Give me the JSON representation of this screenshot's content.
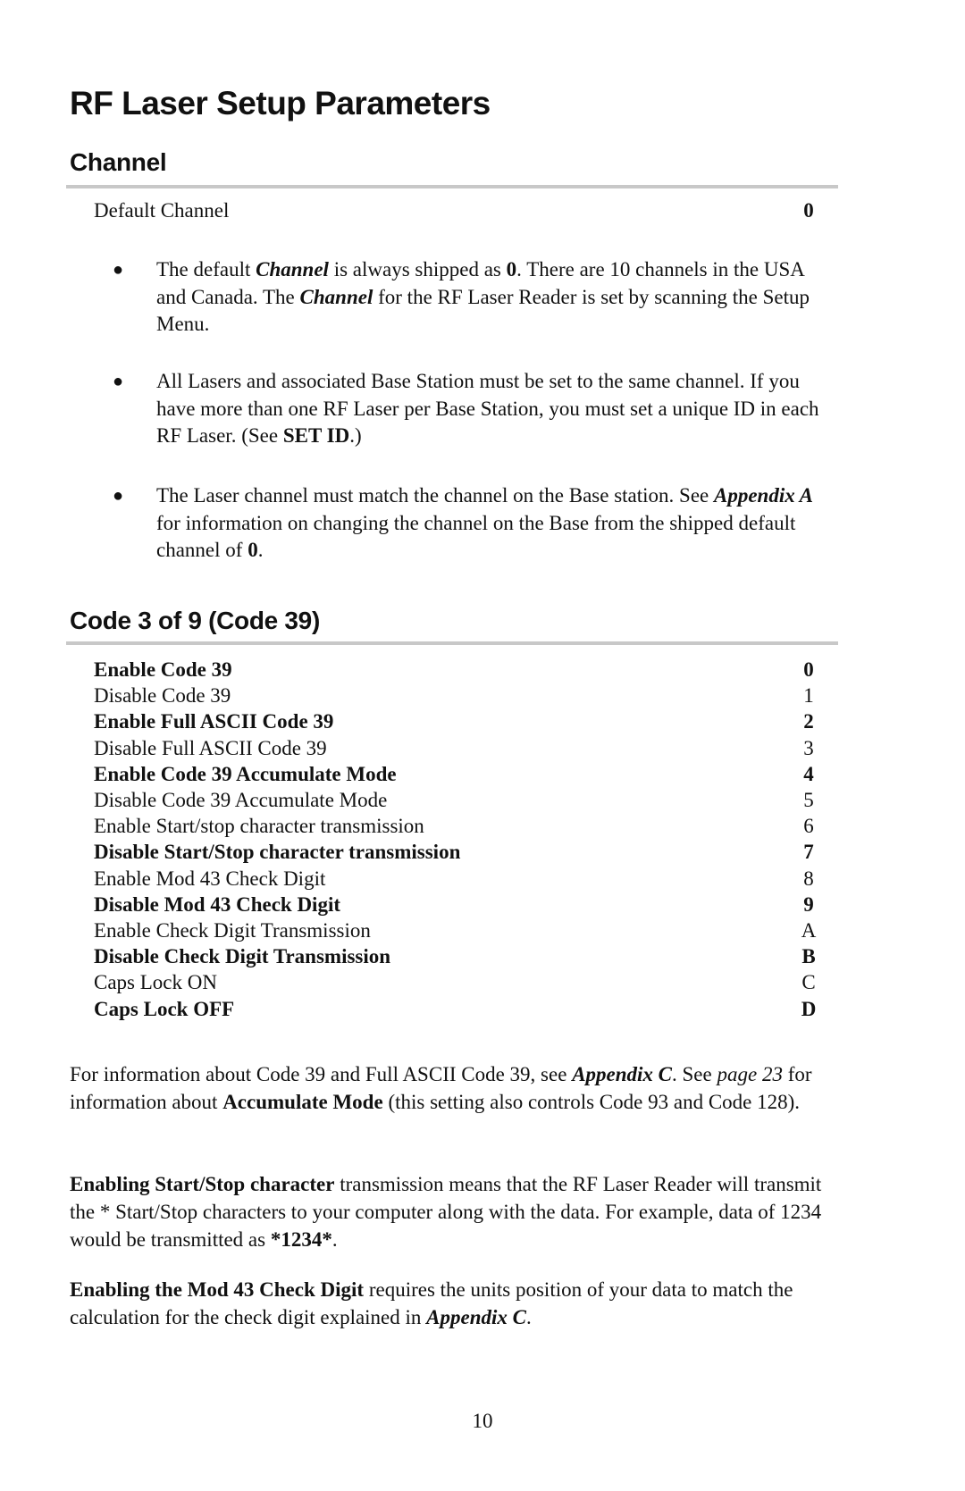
{
  "title": "RF Laser Setup Parameters",
  "channel_section": {
    "heading": "Channel",
    "default_label": "Default Channel",
    "default_value": "0",
    "bullets": [
      {
        "parts": [
          {
            "t": "The default ",
            "s": "n"
          },
          {
            "t": "Channel",
            "s": "bi"
          },
          {
            "t": " is always shipped as ",
            "s": "n"
          },
          {
            "t": "0",
            "s": "b"
          },
          {
            "t": ".  There are 10 channels in the USA and Canada.  The ",
            "s": "n"
          },
          {
            "t": "Channel",
            "s": "bi"
          },
          {
            "t": " for the RF Laser Reader is set by scanning the Setup Menu.",
            "s": "n"
          }
        ]
      },
      {
        "parts": [
          {
            "t": "All Lasers and associated Base Station must be set to the same channel. If you have more than one RF Laser per Base Station, you must set a unique ID in each RF Laser. (See ",
            "s": "n"
          },
          {
            "t": "SET ID",
            "s": "b"
          },
          {
            "t": ".)",
            "s": "n"
          }
        ]
      },
      {
        "parts": [
          {
            "t": "The Laser channel must match the channel on the Base station. See ",
            "s": "n"
          },
          {
            "t": "Appendix A",
            "s": "bi"
          },
          {
            "t": " for information on changing the channel on the Base from the shipped default channel of ",
            "s": "n"
          },
          {
            "t": "0",
            "s": "b"
          },
          {
            "t": ".",
            "s": "n"
          }
        ]
      }
    ]
  },
  "code39_section": {
    "heading": "Code 3 of 9 (Code 39)",
    "rows": [
      {
        "label": "Enable Code 39",
        "value": "0",
        "bold": true
      },
      {
        "label": "Disable Code 39",
        "value": "1",
        "bold": false
      },
      {
        "label": "Enable Full ASCII Code 39",
        "value": "2",
        "bold": true
      },
      {
        "label": "Disable Full ASCII Code 39",
        "value": "3",
        "bold": false
      },
      {
        "label": "Enable Code 39 Accumulate Mode",
        "value": "4",
        "bold": true
      },
      {
        "label": "Disable Code 39 Accumulate Mode",
        "value": "5",
        "bold": false
      },
      {
        "label": "Enable Start/stop character transmission",
        "value": "6",
        "bold": false
      },
      {
        "label": "Disable Start/Stop character transmission",
        "value": "7",
        "bold": true
      },
      {
        "label": "Enable Mod 43 Check Digit",
        "value": "8",
        "bold": false
      },
      {
        "label": "Disable Mod 43 Check Digit",
        "value": "9",
        "bold": true
      },
      {
        "label": "Enable Check Digit Transmission",
        "value": "A",
        "bold": false
      },
      {
        "label": "Disable Check Digit Transmission",
        "value": "B",
        "bold": true
      },
      {
        "label": "Caps Lock ON",
        "value": "C",
        "bold": false
      },
      {
        "label": "Caps Lock OFF",
        "value": "D",
        "bold": true
      }
    ],
    "paragraphs": [
      {
        "parts": [
          {
            "t": "For information about Code 39 and Full ASCII Code 39, see ",
            "s": "n"
          },
          {
            "t": "Appendix C",
            "s": "bi"
          },
          {
            "t": ". See ",
            "s": "n"
          },
          {
            "t": "page 23",
            "s": "i"
          },
          {
            "t": " for information about ",
            "s": "n"
          },
          {
            "t": "Accumulate Mode",
            "s": "b"
          },
          {
            "t": " (this setting also controls Code 93 and Code 128).",
            "s": "n"
          }
        ]
      },
      {
        "parts": [
          {
            "t": "Enabling Start/Stop character",
            "s": "b"
          },
          {
            "t": " transmission means that the RF Laser Reader will transmit the * Start/Stop characters to your computer along with the data. For example, data of 1234 would be transmitted as ",
            "s": "n"
          },
          {
            "t": "*1234*",
            "s": "b"
          },
          {
            "t": ".",
            "s": "n"
          }
        ]
      },
      {
        "parts": [
          {
            "t": "Enabling the Mod 43 Check Digit",
            "s": "b"
          },
          {
            "t": " requires the units position of your data to match the calculation for the check digit explained in ",
            "s": "n"
          },
          {
            "t": "Appendix C",
            "s": "bi"
          },
          {
            "t": ".",
            "s": "n"
          }
        ]
      }
    ]
  },
  "page_number": "10"
}
